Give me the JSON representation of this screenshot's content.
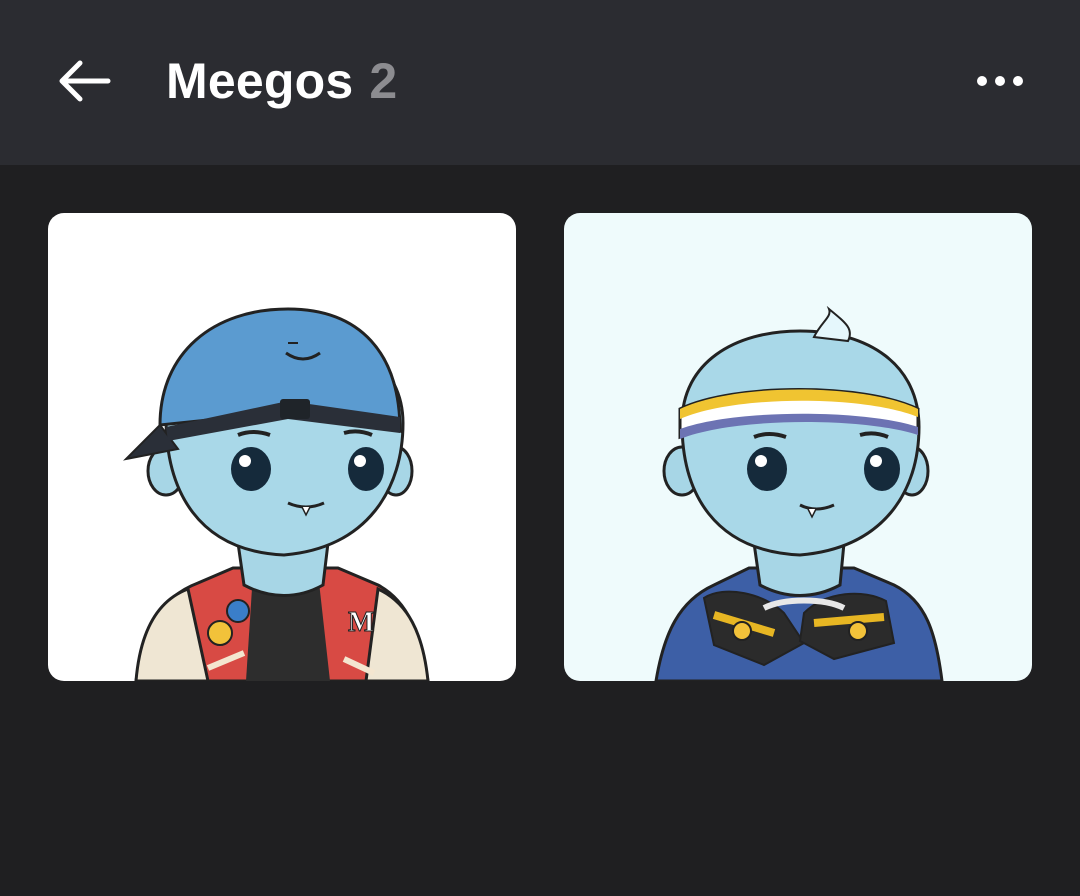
{
  "header": {
    "back_icon": "arrow-left-icon",
    "title": "Meegos",
    "count": "2",
    "more_icon": "more-horizontal-icon"
  },
  "grid": {
    "items": [
      {
        "subject": "meego-cap-varsity-jacket",
        "background": "#ffffff"
      },
      {
        "subject": "meego-headband-sneaker-tee",
        "background": "#effbfc"
      }
    ]
  },
  "colors": {
    "header_bg": "#2b2c31",
    "page_bg": "#1f1f21",
    "title": "#ffffff",
    "count": "#8c8c90"
  }
}
